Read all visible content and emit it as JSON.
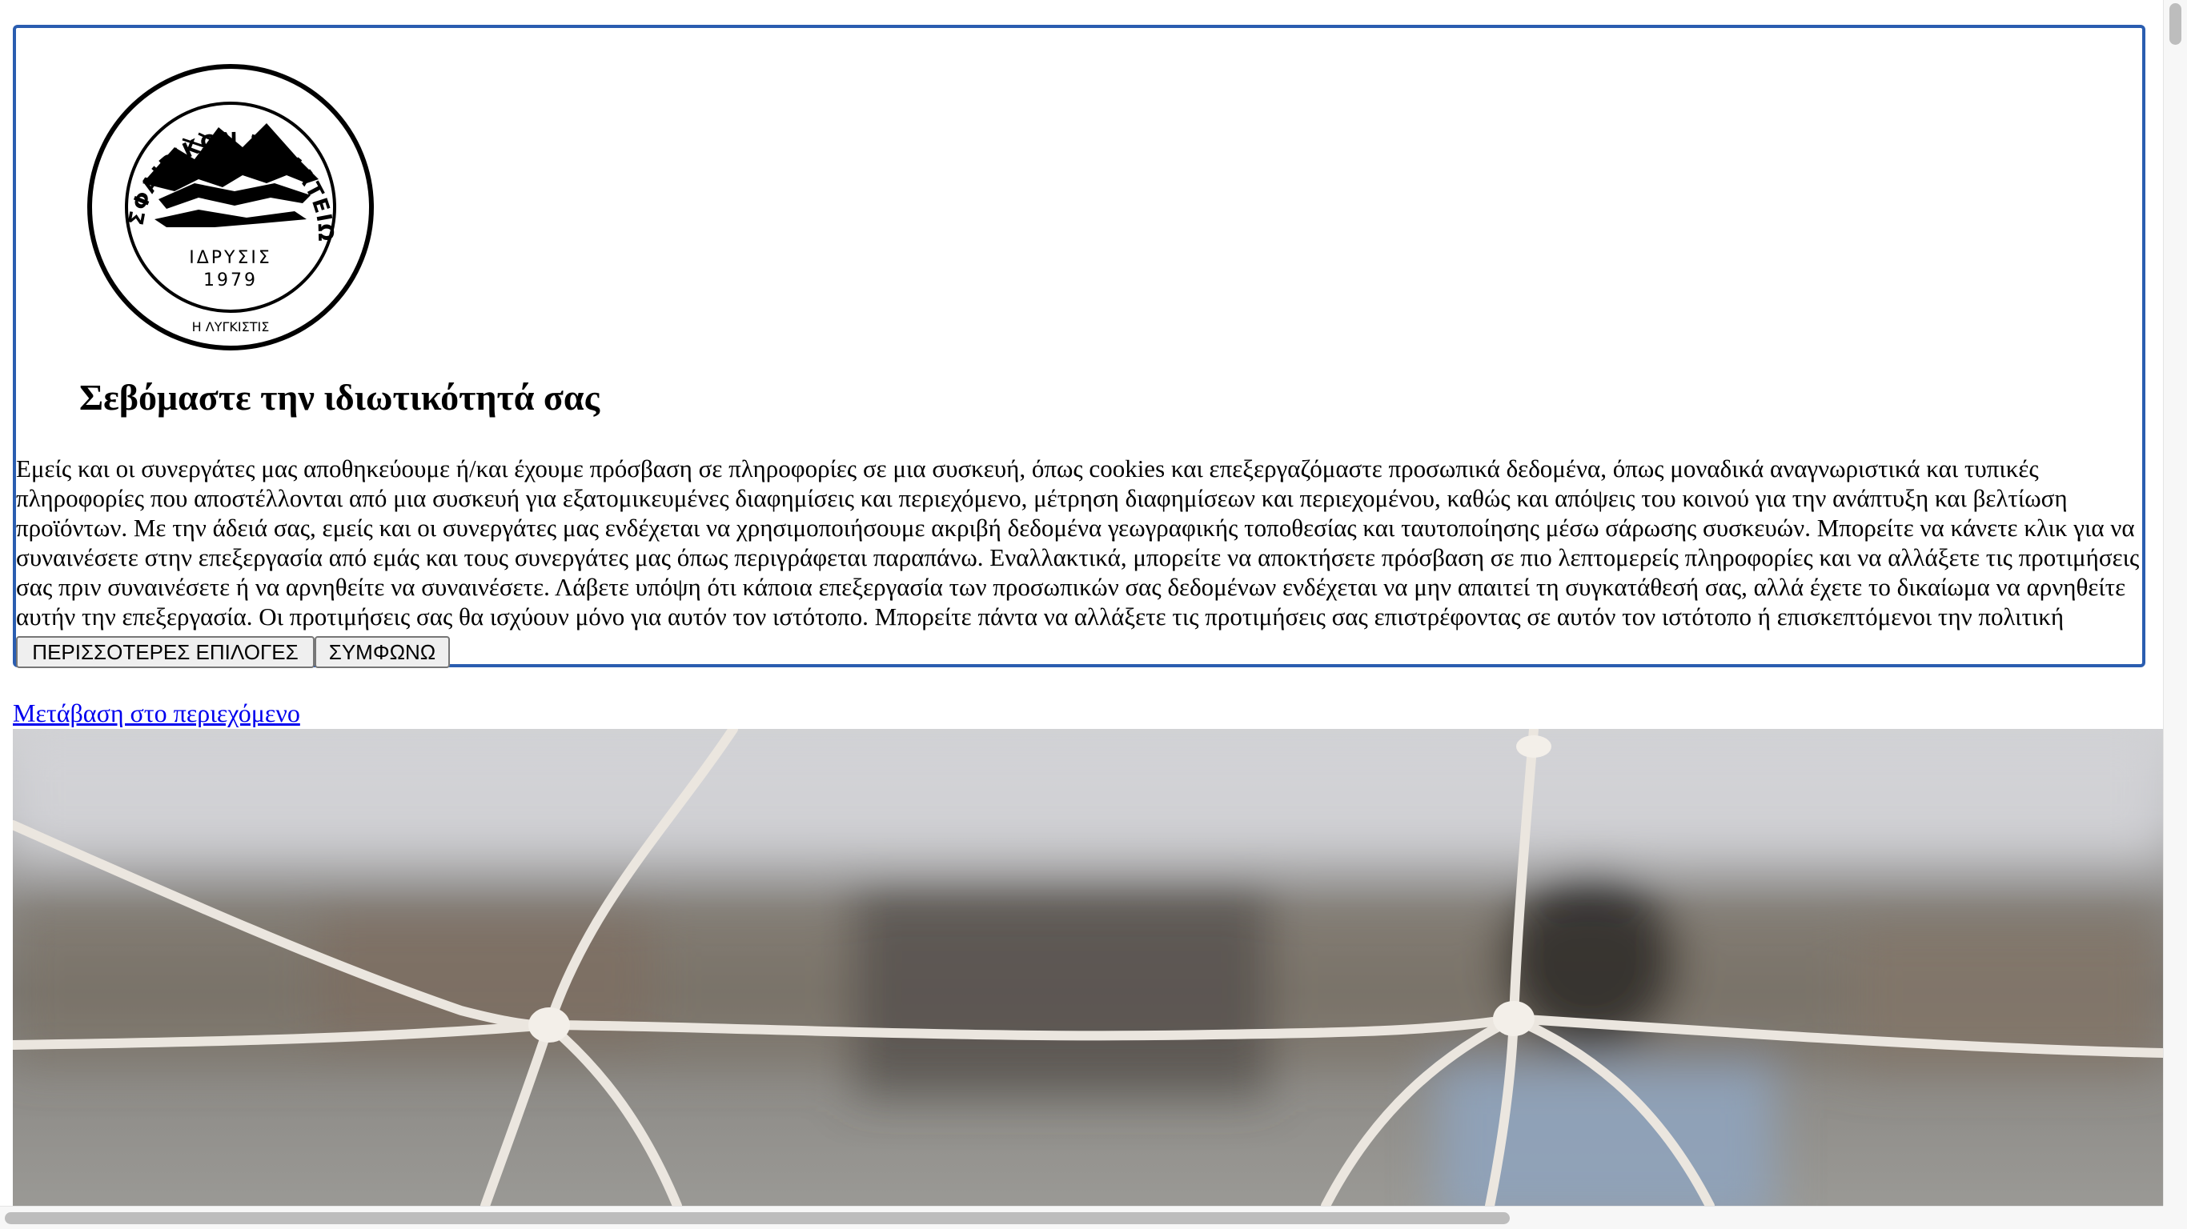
{
  "consent": {
    "logo": {
      "ring_text": "ΕΝΩΣΙΣ ΠΟΔΟΣΦΑΙΡΙΚΩΝ ΣΩΜΑΤΕΙΩΝ ΦΛΩΡΙΝΑΣ",
      "founded_label": "ΙΔΡΥΣΙΣ",
      "founded_year": "1979",
      "bottom_text": "Η ΛΥΓΚΙΣΤΙΣ"
    },
    "title": "Σεβόμαστε την ιδιωτικότητά σας",
    "text": "Εμείς και οι συνεργάτες μας αποθηκεύουμε ή/και έχουμε πρόσβαση σε πληροφορίες σε μια συσκευή, όπως cookies και επεξεργαζόμαστε προσωπικά δεδομένα, όπως μοναδικά αναγνωριστικά και τυπικές πληροφορίες που αποστέλλονται από μια συσκευή για εξατομικευμένες διαφημίσεις και περιεχόμενο, μέτρηση διαφημίσεων και περιεχομένου, καθώς και απόψεις του κοινού για την ανάπτυξη και βελτίωση προϊόντων. Με την άδειά σας, εμείς και οι συνεργάτες μας ενδέχεται να χρησιμοποιήσουμε ακριβή δεδομένα γεωγραφικής τοποθεσίας και ταυτοποίησης μέσω σάρωσης συσκευών. Μπορείτε να κάνετε κλικ για να συναινέσετε στην επεξεργασία από εμάς και τους συνεργάτες μας όπως περιγράφεται παραπάνω. Εναλλακτικά, μπορείτε να αποκτήσετε πρόσβαση σε πιο λεπτομερείς πληροφορίες και να αλλάξετε τις προτιμήσεις σας πριν συναινέσετε ή να αρνηθείτε να συναινέσετε. Λάβετε υπόψη ότι κάποια επεξεργασία των προσωπικών σας δεδομένων ενδέχεται να μην απαιτεί τη συγκατάθεσή σας, αλλά έχετε το δικαίωμα να αρνηθείτε αυτήν την επεξεργασία. Οι προτιμήσεις σας θα ισχύουν μόνο για αυτόν τον ιστότοπο. Μπορείτε πάντα να αλλάξετε τις προτιμήσεις σας επιστρέφοντας σε αυτόν τον ιστότοπο ή επισκεπτόμενοι την πολιτική απορρήτου μας.",
    "buttons": {
      "more_options": "ΠΕΡΙΣΣΟΤΕΡΕΣ ΕΠΙΛΟΓΕΣ",
      "agree": "ΣΥΜΦΩΝΩ"
    },
    "border_color": "#2a5db0"
  },
  "skip_link": "Μετάβαση στο περιεχόμενο",
  "hero": {
    "image": "football-goal-net-photo"
  },
  "colors": {
    "link": "#0000ee",
    "scrollbar_thumb": "#bdbdbd"
  }
}
